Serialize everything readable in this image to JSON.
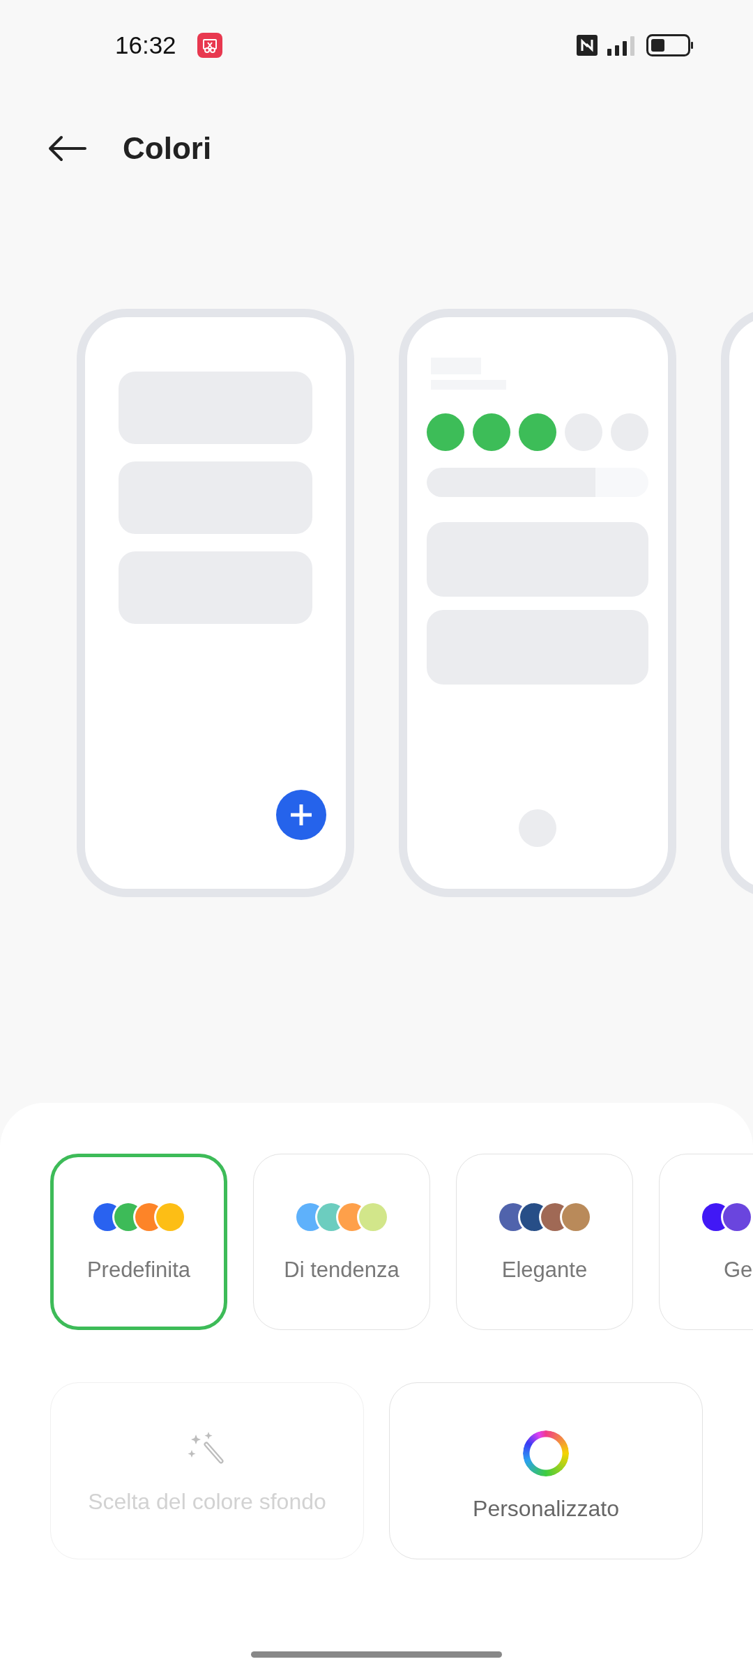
{
  "status_bar": {
    "time": "16:32"
  },
  "header": {
    "title": "Colori"
  },
  "palettes": [
    {
      "label": "Predefinita",
      "selected": true,
      "swatches": [
        {
          "color": "#2962f0"
        },
        {
          "color": "#3dbb58"
        },
        {
          "color": "#fd8428"
        },
        {
          "color": "#fdbe15"
        }
      ]
    },
    {
      "label": "Di tendenza",
      "selected": false,
      "swatches": [
        {
          "color": "#5eb1fb"
        },
        {
          "color": "#6ccdbf"
        },
        {
          "color": "#fea04a"
        },
        {
          "color": "#d2e68a"
        }
      ]
    },
    {
      "label": "Elegante",
      "selected": false,
      "swatches": [
        {
          "color": "#5063ac"
        },
        {
          "color": "#274e87"
        },
        {
          "color": "#a06955"
        },
        {
          "color": "#b98a5a"
        }
      ]
    },
    {
      "label": "Ge",
      "selected": false,
      "swatches": [
        {
          "color": "#4118f5"
        },
        {
          "color": "#6a45de"
        }
      ]
    }
  ],
  "actions": [
    {
      "label": "Scelta del colore sfondo",
      "disabled": true
    },
    {
      "label": "Personalizzato",
      "disabled": false
    }
  ]
}
